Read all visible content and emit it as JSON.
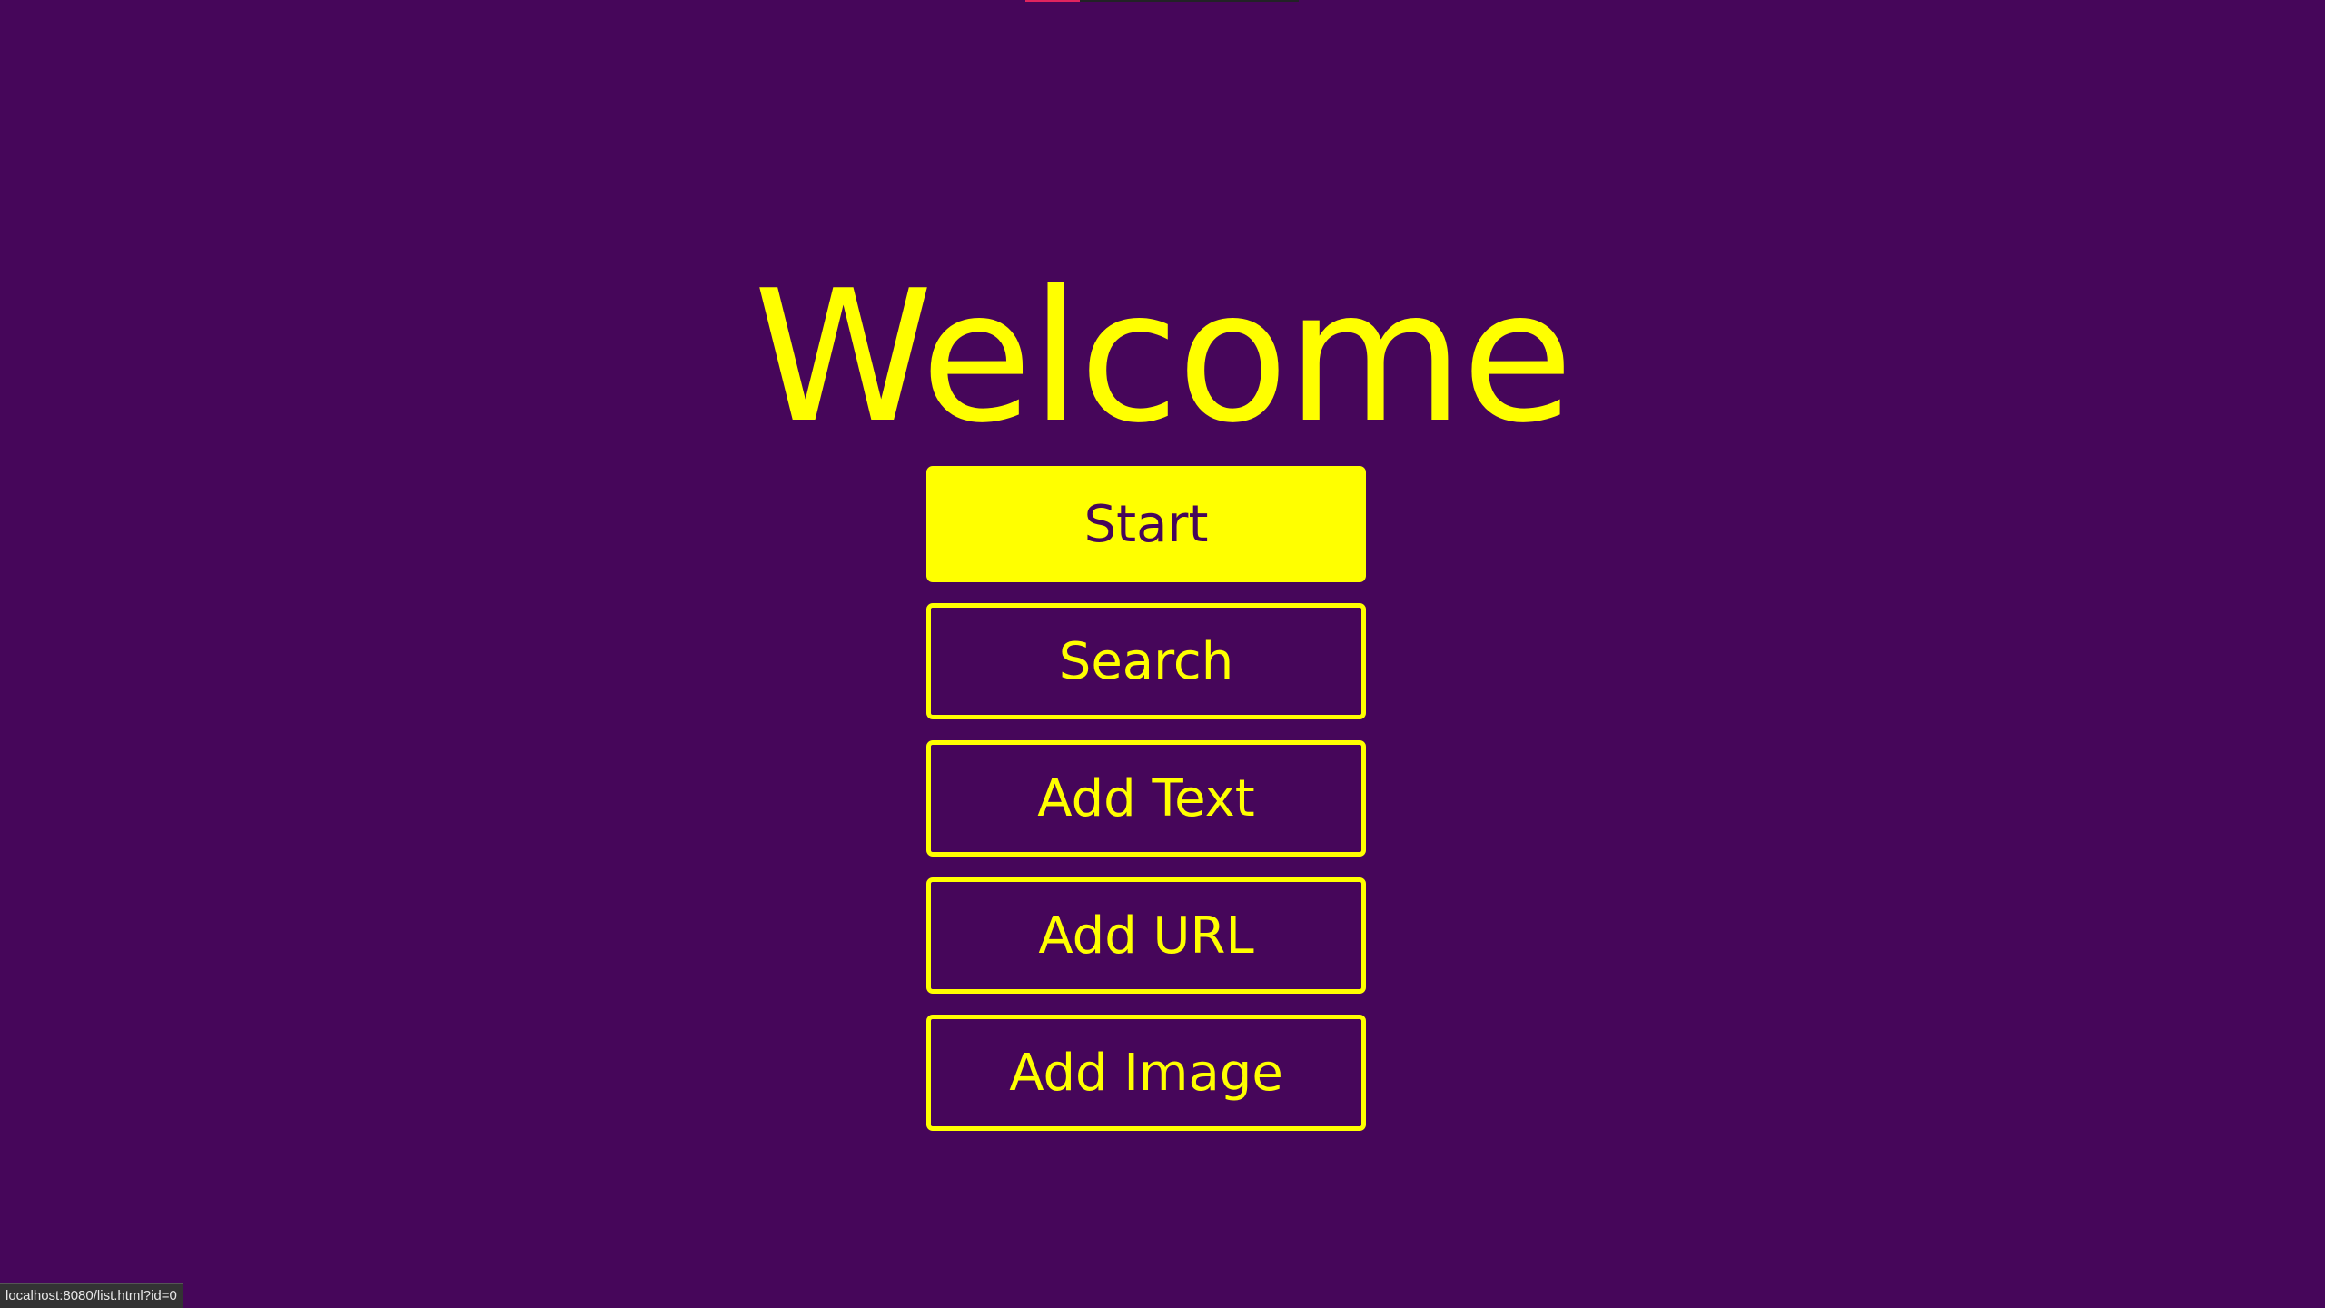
{
  "colors": {
    "background": "#46065a",
    "accent": "#ffff00",
    "loading_bar": "#e0245e"
  },
  "loading": {
    "progress_percent": 20
  },
  "header": {
    "title": "Welcome"
  },
  "menu": {
    "buttons": [
      {
        "label": "Start",
        "style": "filled"
      },
      {
        "label": "Search",
        "style": "outline"
      },
      {
        "label": "Add Text",
        "style": "outline"
      },
      {
        "label": "Add URL",
        "style": "outline"
      },
      {
        "label": "Add Image",
        "style": "outline"
      }
    ]
  },
  "status_bar": {
    "url": "localhost:8080/list.html?id=0"
  }
}
